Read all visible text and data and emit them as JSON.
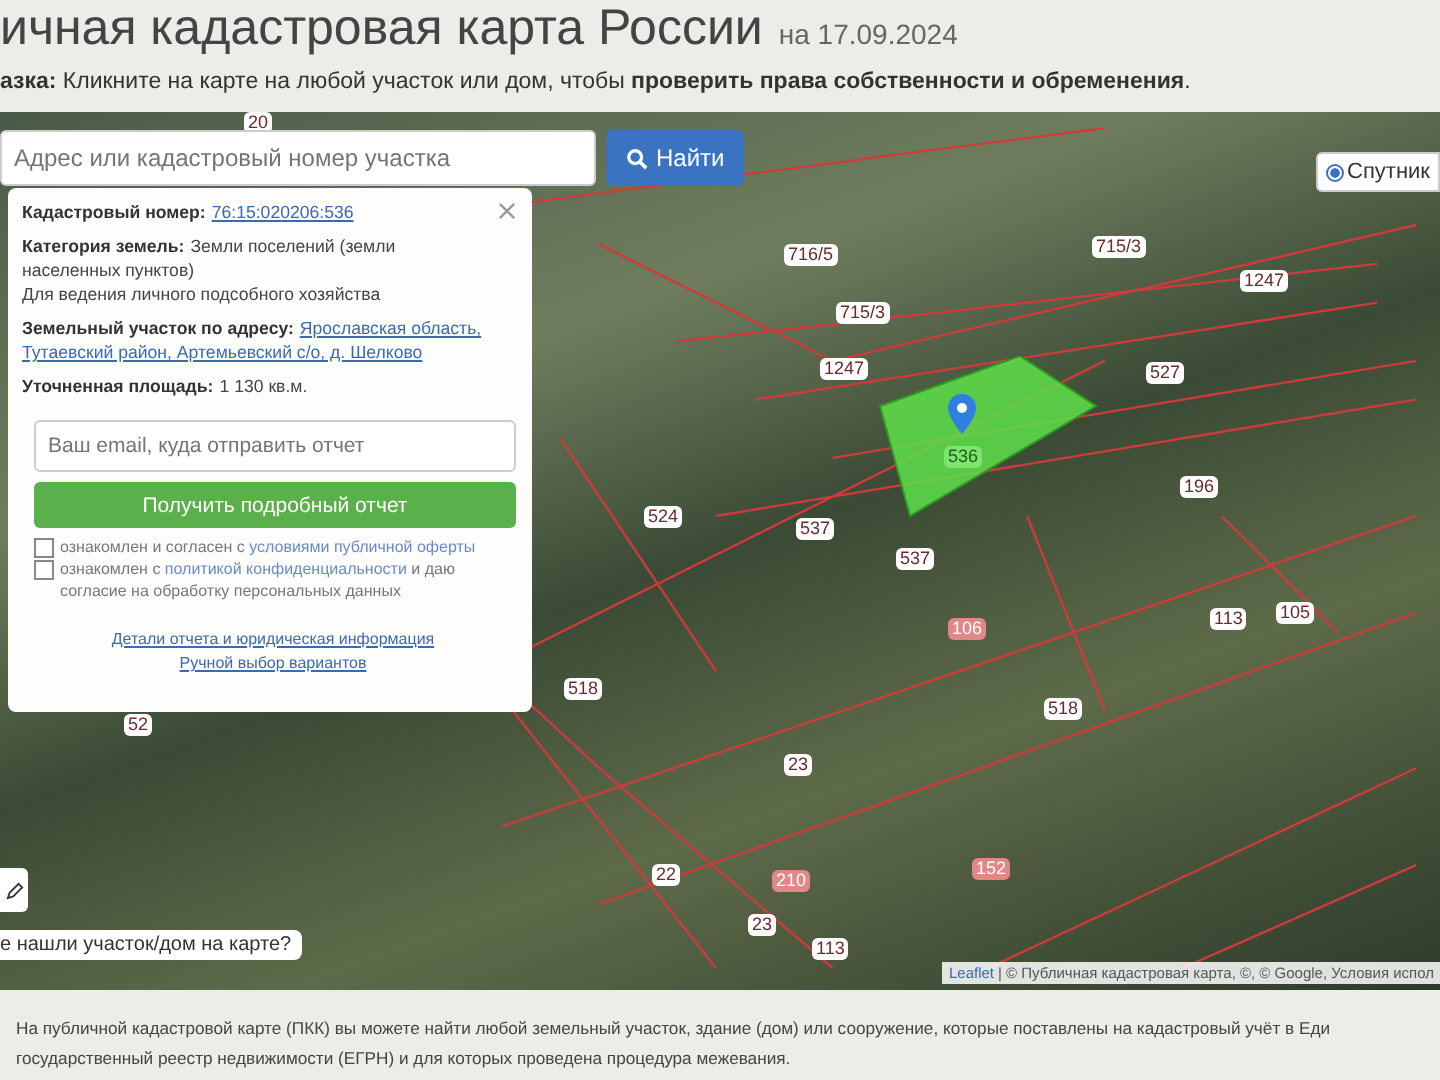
{
  "header": {
    "title": "ичная кадастровая карта России",
    "date": "на 17.09.2024",
    "hint": "**азка:** Кликните на карте на любой участок или дом, чтобы **проверить права собственности и обременения**."
  },
  "search": {
    "placeholder": "Адрес или кадастровый номер участка",
    "button": "Найти"
  },
  "layer_toggle": {
    "label": "Спутник",
    "selected": true
  },
  "parcel_labels": [
    {
      "text": "20",
      "kind": "plot"
    },
    {
      "text": "716/5",
      "kind": "plot"
    },
    {
      "text": "715/3",
      "kind": "plot"
    },
    {
      "text": "715/3",
      "kind": "plot"
    },
    {
      "text": "1247",
      "kind": "plot"
    },
    {
      "text": "1247",
      "kind": "plot"
    },
    {
      "text": "527",
      "kind": "plot"
    },
    {
      "text": "536",
      "kind": "selected"
    },
    {
      "text": "537",
      "kind": "plot"
    },
    {
      "text": "537",
      "kind": "plot"
    },
    {
      "text": "524",
      "kind": "plot"
    },
    {
      "text": "196",
      "kind": "plot"
    },
    {
      "text": "105",
      "kind": "plot"
    },
    {
      "text": "106",
      "kind": "building"
    },
    {
      "text": "518",
      "kind": "plot"
    },
    {
      "text": "23",
      "kind": "plot"
    },
    {
      "text": "518",
      "kind": "plot"
    },
    {
      "text": "52",
      "kind": "plot"
    },
    {
      "text": "22",
      "kind": "plot"
    },
    {
      "text": "210",
      "kind": "building"
    },
    {
      "text": "23",
      "kind": "plot"
    },
    {
      "text": "152",
      "kind": "building"
    },
    {
      "text": "113",
      "kind": "plot"
    },
    {
      "text": "113",
      "kind": "plot"
    }
  ],
  "popup": {
    "fields": [
      {
        "label": "Кадастровый номер:",
        "values": [
          "76:15:020206:536"
        ],
        "kind": "link"
      },
      {
        "label": "Категория земель:",
        "values": [
          "Земли поселений (земли",
          "населенных пунктов)"
        ],
        "kind": "text"
      },
      {
        "values": [
          "Для ведения личного подсобного хозяйства"
        ],
        "kind": "note"
      },
      {
        "label": "Земельный участок по адресу:",
        "values": [
          "Ярославская область,",
          "Тутаевский район, Артемьевский с/о, д. Шелково"
        ],
        "kind": "link"
      },
      {
        "label": "Уточненная площадь:",
        "values": [
          "1 130 кв.м."
        ],
        "kind": "text"
      }
    ],
    "email_placeholder": "Ваш email, куда отправить отчет",
    "submit": "Получить подробный отчет",
    "agreements": [
      {
        "text": "ознакомлен и согласен с ",
        "link": "условиями публичной оферты",
        "checked": false
      },
      {
        "text": "ознакомлен с ",
        "link": "политикой конфиденциальности",
        "rest": " и даю согласие на обработку персональных данных",
        "checked": false
      }
    ],
    "links": [
      "Детали отчета и юридическая информация",
      "Ручной выбор вариантов"
    ]
  },
  "not_found_button": "е нашли участок/дом на карте?",
  "attribution": {
    "link": "Leaflet",
    "text": "| © Публичная кадастровая карта, ©, © Google, Условия испол"
  },
  "footer": "На публичной кадастровой карте (ПКК) вы можете найти любой земельный участок, здание (дом) или сооружение, которые поставлены на кадастровый учёт в Еди\nгосударственный реестр недвижимости (ЕГРН) и для которых проведена процедура межевания."
}
